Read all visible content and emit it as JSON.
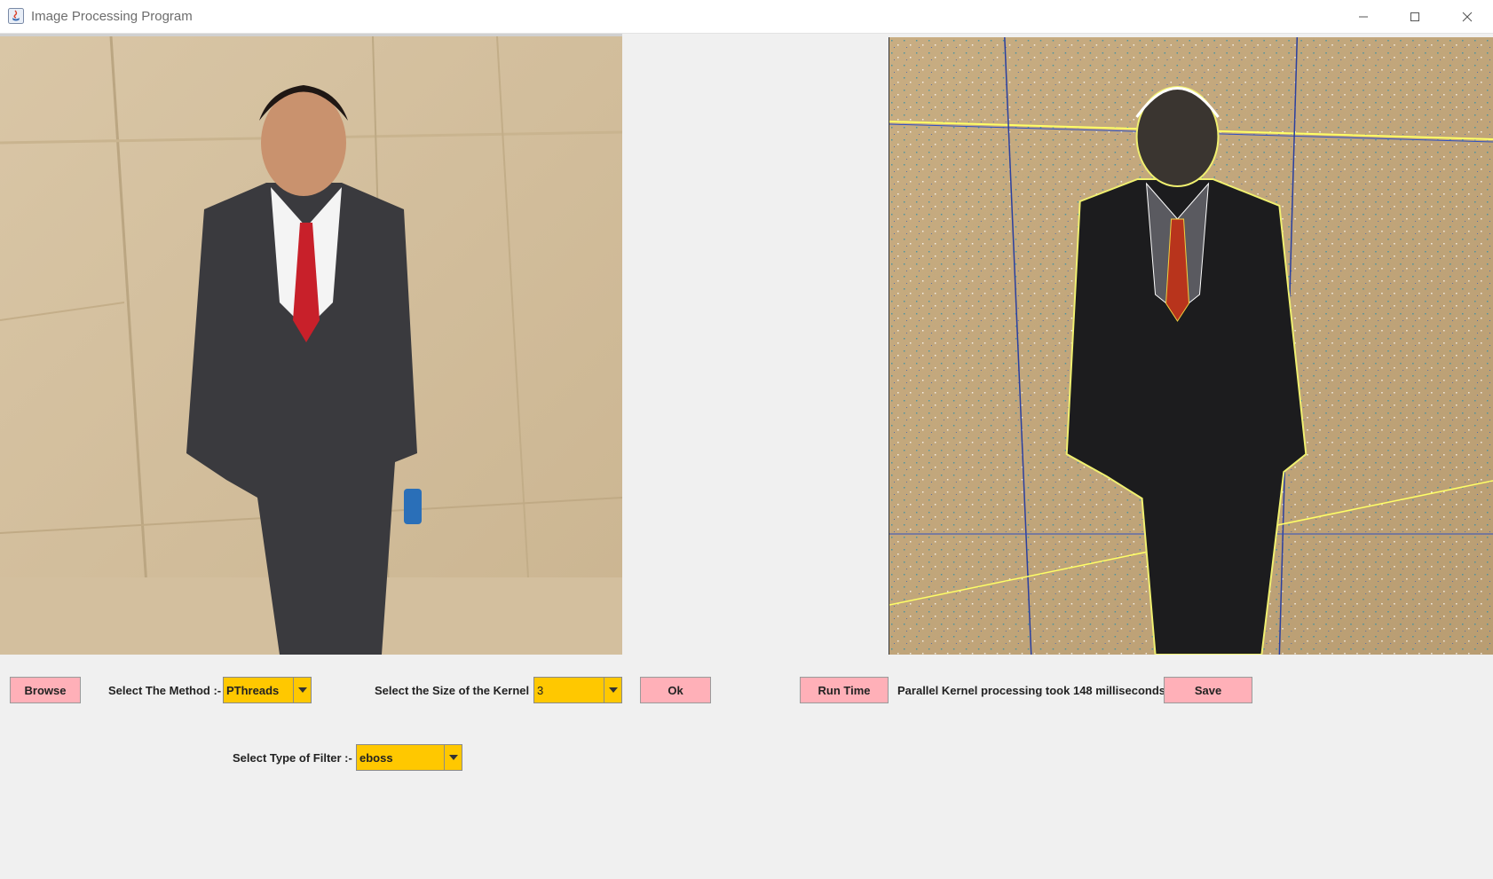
{
  "window": {
    "title": "Image Processing Program",
    "icons": [
      "java-app-icon",
      "minimize-icon",
      "maximize-icon",
      "close-icon"
    ]
  },
  "images": {
    "original": "original-photo",
    "processed": "processed-photo-emboss"
  },
  "controls": {
    "browse_label": "Browse",
    "method_label": "Select The Method :-",
    "method_value": "PThreads",
    "kernel_label": "Select the Size of the Kernel :-",
    "kernel_value": "3",
    "ok_label": "Ok",
    "runtime_label": "Run Time",
    "runtime_status": "Parallel Kernel processing took 148 milliseconds",
    "save_label": "Save",
    "filter_label": "Select Type of Filter :-",
    "filter_value": "eboss"
  },
  "colors": {
    "button_bg": "#ffb0b8",
    "combo_bg": "#ffc800",
    "window_bg": "#f0f0f0"
  }
}
